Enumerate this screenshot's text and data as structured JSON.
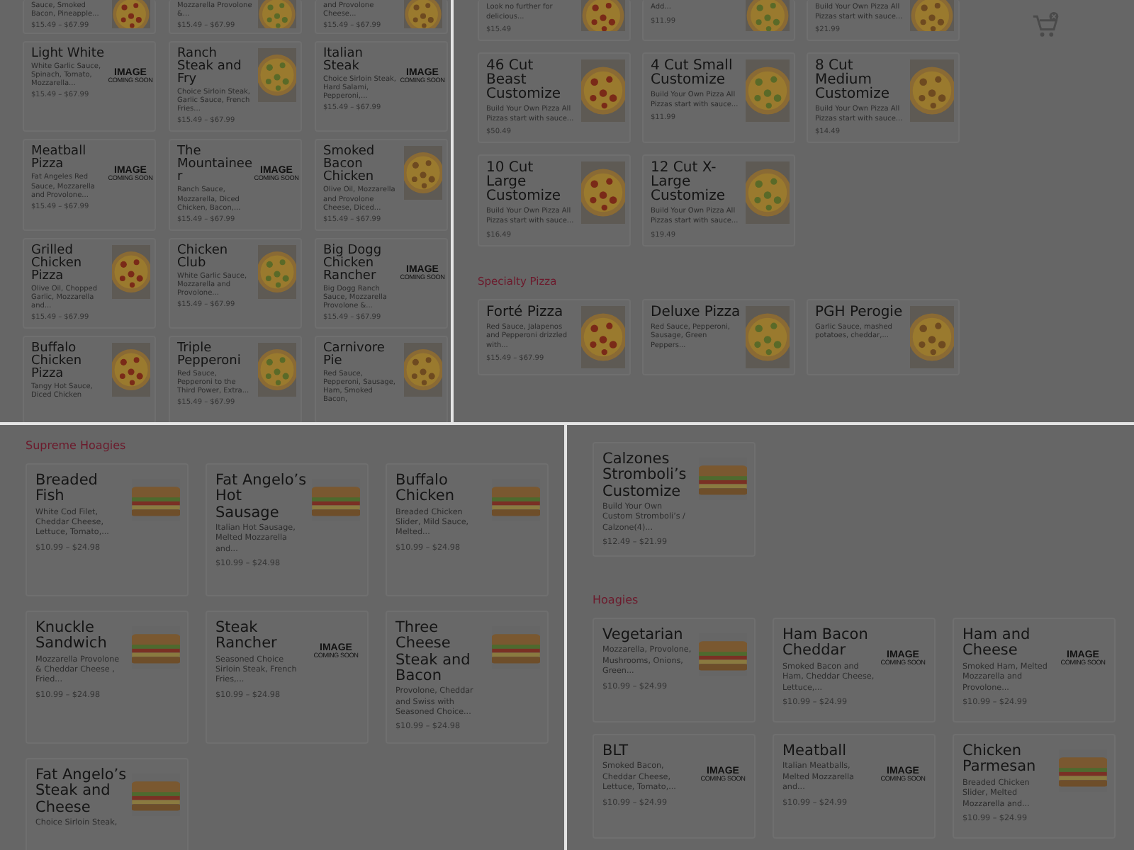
{
  "panels": [
    {
      "sections": [
        {
          "items": [
            {
              "description": "Sauce, Smoked Bacon, Pineapple...",
              "price": "$15.49 – $67.99"
            },
            {
              "description": "Mozzarella Provolone &...",
              "price": "$15.49 – $67.99"
            },
            {
              "description": "and Provolone Cheese...",
              "price": "$15.49 – $67.99"
            },
            {
              "name": "Light White",
              "description": "White Garlic Sauce, Spinach, Tomato, Mozzarella...",
              "price": "$15.49 – $67.99",
              "kind": "coming_soon",
              "image_label": "IMAGE",
              "image_caption": "COMING SOON"
            },
            {
              "name": "Ranch Steak and Fry",
              "description": "Choice Sirloin Steak, Garlic Sauce, French Fries...",
              "price": "$15.49 – $67.99"
            },
            {
              "name": "Italian Steak",
              "description": "Choice Sirloin Steak, Hard Salami, Pepperoni,...",
              "price": "$15.49 – $67.99",
              "kind": "coming_soon",
              "image_label": "IMAGE",
              "image_caption": "COMING SOON"
            },
            {
              "name": "Meatball Pizza",
              "description": "Fat Angeles Red Sauce, Mozzarella and Provolone...",
              "price": "$15.49 – $67.99",
              "kind": "coming_soon",
              "image_label": "IMAGE",
              "image_caption": "COMING SOON"
            },
            {
              "name": "The Mountaineer",
              "description": "Ranch Sauce, Mozzarella, Diced Chicken, Bacon,...",
              "price": "$15.49 – $67.99",
              "kind": "coming_soon",
              "image_label": "IMAGE",
              "image_caption": "COMING SOON"
            },
            {
              "name": "Smoked Bacon Chicken",
              "description": "Olive Oil, Mozzarella and Provolone Cheese, Diced...",
              "price": "$15.49 – $67.99"
            },
            {
              "name": "Grilled Chicken Pizza",
              "description": "Olive Oil, Chopped Garlic, Mozzarella and...",
              "price": "$15.49 – $67.99"
            },
            {
              "name": "Chicken Club",
              "description": "White Garlic Sauce, Mozzarella and Provolone...",
              "price": "$15.49 – $67.99"
            },
            {
              "name": "Big Dogg Chicken Rancher",
              "description": "Big Dogg Ranch Sauce, Mozzarella Provolone &...",
              "price": "$15.49 – $67.99",
              "kind": "coming_soon",
              "image_label": "IMAGE",
              "image_caption": "COMING SOON"
            },
            {
              "name": "Buffalo Chicken Pizza",
              "description": "Tangy Hot Sauce, Diced Chicken"
            },
            {
              "name": "Triple Pepperoni",
              "description": "Red Sauce, Pepperoni to the Third Power, Extra...",
              "price": "$15.49 – $67.99"
            },
            {
              "name": "Carnivore Pie",
              "description": "Red Sauce, Pepperoni, Sausage, Ham, Smoked Bacon,"
            }
          ]
        }
      ]
    },
    {
      "sections": [
        {
          "items": [
            {
              "description": "Look no further for delicious...",
              "price": "$15.49"
            },
            {
              "description": "Add...",
              "price": "$11.99"
            },
            {
              "description": "Build Your Own Pizza All Pizzas start with sauce...",
              "price": "$21.99"
            },
            {
              "name": "46 Cut Beast Customize",
              "description": "Build Your Own Pizza All Pizzas start with sauce...",
              "price": "$50.49"
            },
            {
              "name": "4 Cut Small Customize",
              "description": "Build Your Own Pizza All Pizzas start with sauce...",
              "price": "$11.99"
            },
            {
              "name": "8 Cut Medium Customize",
              "description": "Build Your Own Pizza All Pizzas start with sauce...",
              "price": "$14.49"
            },
            {
              "name": "10 Cut Large Customize",
              "description": "Build Your Own Pizza All Pizzas start with sauce...",
              "price": "$16.49"
            },
            {
              "name": "12 Cut X-Large Customize",
              "description": "Build Your Own Pizza All Pizzas start with sauce...",
              "price": "$19.49"
            }
          ]
        },
        {
          "heading": "Specialty Pizza",
          "items": [
            {
              "name": "Forté Pizza",
              "description": "Red Sauce, Jalapenos and Pepperoni drizzled with...",
              "price": "$15.49 – $67.99"
            },
            {
              "name": "Deluxe Pizza",
              "description": "Red Sauce, Pepperoni, Sausage, Green Peppers..."
            },
            {
              "name": "PGH Perogie",
              "description": "Garlic Sauce, mashed potatoes, cheddar,..."
            }
          ]
        }
      ]
    },
    {
      "sections": [
        {
          "heading": "Supreme Hoagies",
          "items": [
            {
              "name": "Breaded Fish",
              "description": "White Cod Filet, Cheddar Cheese, Lettuce, Tomato,...",
              "price": "$10.99 – $24.98"
            },
            {
              "name": "Fat Angelo’s Hot Sausage",
              "description": "Italian Hot Sausage, Melted Mozzarella and...",
              "price": "$10.99 – $24.98"
            },
            {
              "name": "Buffalo Chicken",
              "description": "Breaded Chicken Slider, Mild Sauce, Melted...",
              "price": "$10.99 – $24.98"
            },
            {
              "name": "Knuckle Sandwich",
              "description": "Mozzarella Provolone & Cheddar Cheese , Fried...",
              "price": "$10.99 – $24.98"
            },
            {
              "name": "Steak Rancher",
              "description": "Seasoned Choice Sirloin Steak, French Fries,...",
              "price": "$10.99 – $24.98",
              "kind": "coming_soon",
              "image_label": "IMAGE",
              "image_caption": "COMING SOON"
            },
            {
              "name": "Three Cheese Steak and Bacon",
              "description": "Provolone, Cheddar and Swiss with Seasoned Choice...",
              "price": "$10.99 – $24.98"
            },
            {
              "name": "Fat Angelo’s Steak and Cheese",
              "description": "Choice Sirloin Steak,"
            }
          ]
        }
      ]
    },
    {
      "sections": [
        {
          "items": [
            {
              "name": "Calzones Stromboli’s Customize",
              "description": "Build Your Own Custom Stromboli’s / Calzone(4)...",
              "price": "$12.49 – $21.99"
            }
          ]
        },
        {
          "heading": "Hoagies",
          "items": [
            {
              "name": "Vegetarian",
              "description": "Mozzarella, Provolone, Mushrooms, Onions, Green...",
              "price": "$10.99 – $24.99"
            },
            {
              "name": "Ham Bacon Cheddar",
              "description": "Smoked Bacon and Ham, Cheddar Cheese, Lettuce,...",
              "price": "$10.99 – $24.99",
              "kind": "coming_soon",
              "image_label": "IMAGE",
              "image_caption": "COMING SOON"
            },
            {
              "name": "Ham and Cheese",
              "description": "Smoked Ham, Melted Mozzarella and Provolone...",
              "price": "$10.99 – $24.99",
              "kind": "coming_soon",
              "image_label": "IMAGE",
              "image_caption": "COMING SOON"
            },
            {
              "name": "BLT",
              "description": "Smoked Bacon, Cheddar Cheese, Lettuce, Tomato,...",
              "price": "$10.99 – $24.99",
              "kind": "coming_soon",
              "image_label": "IMAGE",
              "image_caption": "COMING SOON"
            },
            {
              "name": "Meatball",
              "description": "Italian Meatballs, Melted Mozzarella and...",
              "price": "$10.99 – $24.99",
              "kind": "coming_soon",
              "image_label": "IMAGE",
              "image_caption": "COMING SOON"
            },
            {
              "name": "Chicken Parmesan",
              "description": "Breaded Chicken Slider, Melted Mozzarella and...",
              "price": "$10.99 – $24.99"
            }
          ]
        }
      ]
    }
  ]
}
